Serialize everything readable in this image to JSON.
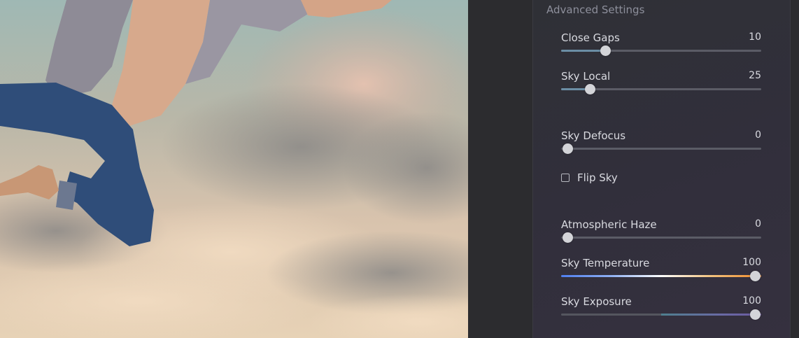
{
  "panel": {
    "section_title": "Advanced Settings",
    "sliders": [
      {
        "label": "Close Gaps",
        "value": "10",
        "fraction": 0.22
      },
      {
        "label": "Sky Local",
        "value": "25",
        "fraction": 0.145
      },
      {
        "label": "Sky Defocus",
        "value": "0",
        "fraction": 0.03
      },
      {
        "label": "Atmospheric Haze",
        "value": "0",
        "fraction": 0.03
      },
      {
        "label": "Sky Temperature",
        "value": "100",
        "fraction": 0.97
      },
      {
        "label": "Sky Exposure",
        "value": "100",
        "fraction": 0.97
      }
    ],
    "flip_sky": {
      "label": "Flip Sky",
      "checked": false
    }
  },
  "colors": {
    "panel_bg": "#312f3b",
    "slider_fill": "#6b8ea5",
    "thumb": "#d3d4d8",
    "temperature_cold": "#4f7ff0",
    "temperature_warm": "#f08a2a"
  }
}
